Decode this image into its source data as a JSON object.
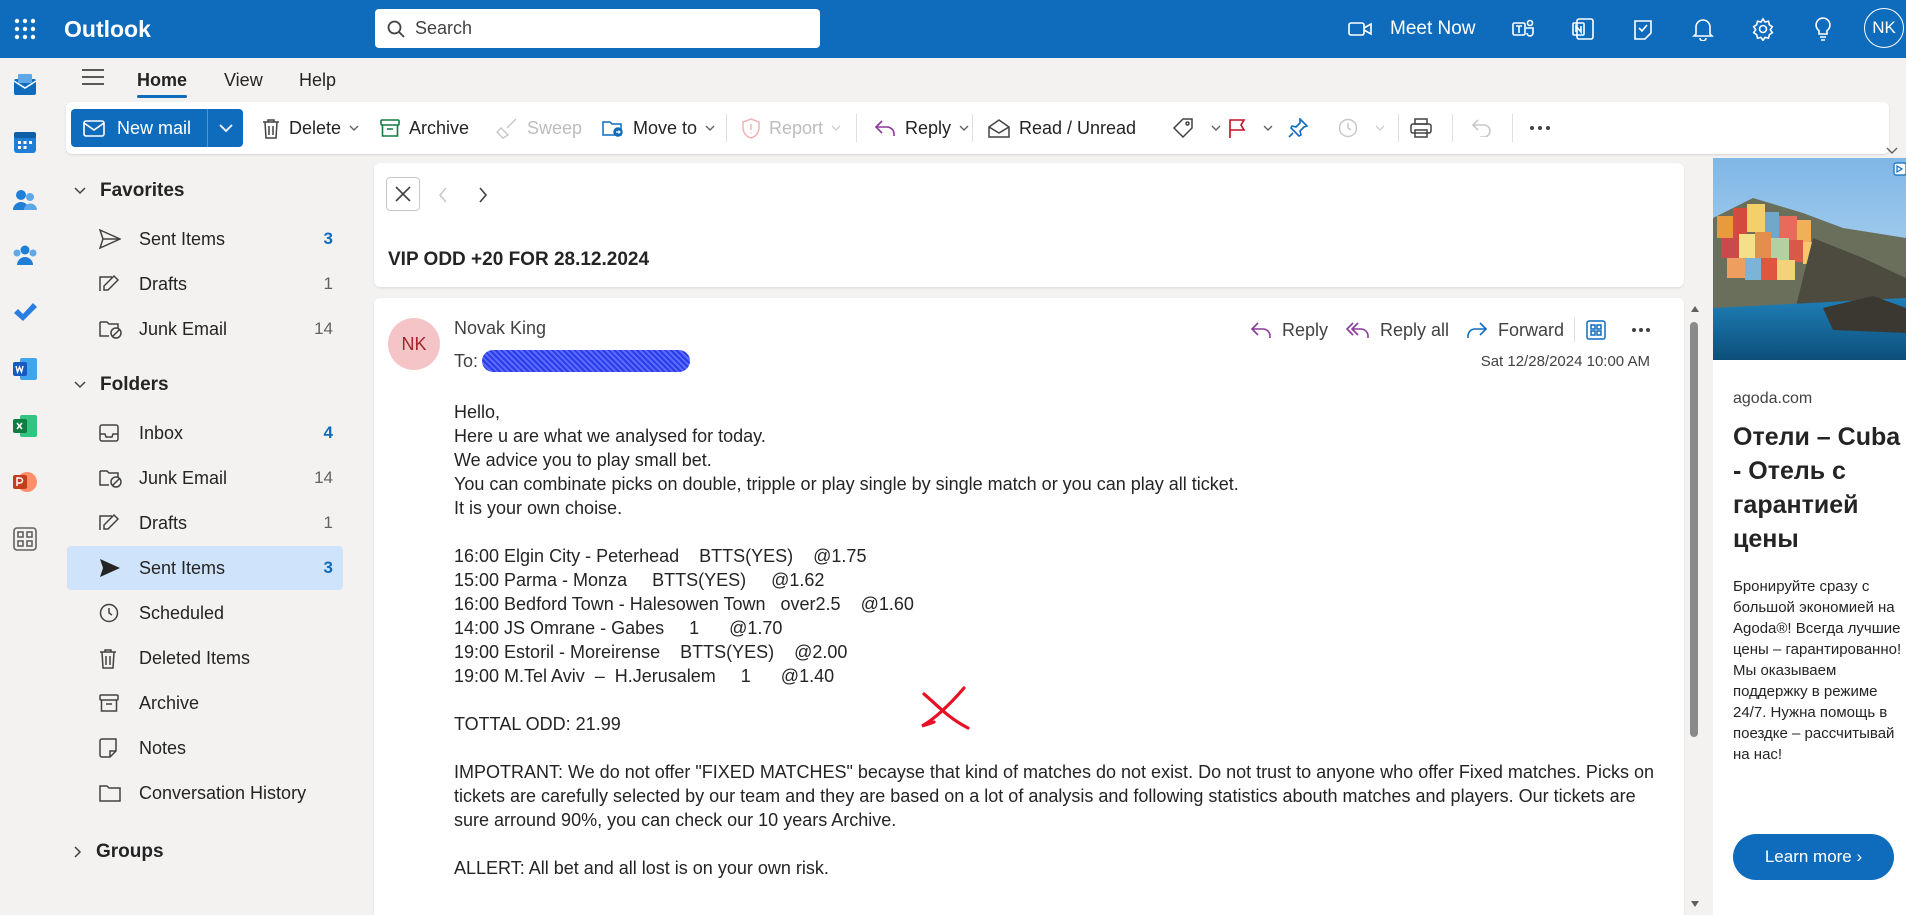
{
  "app": {
    "name": "Outlook",
    "user_initials": "NK"
  },
  "search": {
    "placeholder": "Search"
  },
  "topbar": {
    "meet_now": "Meet Now"
  },
  "tabs": [
    "Home",
    "View",
    "Help"
  ],
  "ribbon": {
    "new_mail": "New mail",
    "delete": "Delete",
    "archive": "Archive",
    "sweep": "Sweep",
    "move_to": "Move to",
    "report": "Report",
    "reply": "Reply",
    "read_unread": "Read / Unread"
  },
  "favorites": {
    "heading": "Favorites",
    "items": [
      {
        "label": "Sent Items",
        "count": "3"
      },
      {
        "label": "Drafts",
        "count": "1"
      },
      {
        "label": "Junk Email",
        "count": "14"
      }
    ]
  },
  "folders": {
    "heading": "Folders",
    "items": [
      {
        "label": "Inbox",
        "count": "4"
      },
      {
        "label": "Junk Email",
        "count": "14"
      },
      {
        "label": "Drafts",
        "count": "1"
      },
      {
        "label": "Sent Items",
        "count": "3"
      },
      {
        "label": "Scheduled",
        "count": ""
      },
      {
        "label": "Deleted Items",
        "count": ""
      },
      {
        "label": "Archive",
        "count": ""
      },
      {
        "label": "Notes",
        "count": ""
      },
      {
        "label": "Conversation History",
        "count": ""
      }
    ]
  },
  "groups": {
    "heading": "Groups"
  },
  "message": {
    "subject": "VIP ODD +20 FOR 28.12.2024",
    "sender_initials": "NK",
    "sender_name": "Novak King",
    "to_label": "To:",
    "date": "Sat 12/28/2024 10:00 AM",
    "actions": {
      "reply": "Reply",
      "reply_all": "Reply all",
      "forward": "Forward"
    },
    "body": {
      "intro": [
        "Hello,",
        "Here u are what we analysed for today.",
        "We advice you to play small bet.",
        "You can combinate picks on double, tripple or play single by single match or you can play all ticket.",
        "It is your own choise."
      ],
      "picks": [
        "16:00 Elgin City - Peterhead    BTTS(YES)    @1.75",
        "15:00 Parma - Monza     BTTS(YES)     @1.62",
        "16:00 Bedford Town - Halesowen Town   over2.5    @1.60",
        "14:00 JS Omrane - Gabes     1      @1.70",
        "19:00 Estoril - Moreirense    BTTS(YES)    @2.00",
        "19:00 M.Tel Aviv  –  H.Jerusalem     1      @1.40"
      ],
      "total": "TOTTAL ODD: 21.99",
      "important": "IMPOTRANT: We do not offer \"FIXED MATCHES\" becayse that kind of matches do not exist. Do not trust to anyone who offer Fixed matches. Picks on tickets are carefully selected by our team and they are based on a lot of analysis and following statistics abouth matches and players. Our tickets are sure arround 90%, you can check our 10 years Archive.",
      "alert": "ALLERT: All bet and all lost is on your own risk."
    }
  },
  "ad": {
    "domain": "agoda.com",
    "title": "Отели – Cuba - Отель с гарантией цены",
    "text": "Бронируйте сразу с большой экономией на Agoda®! Всегда лучшие цены – гарантированно! Мы оказываем поддержку в режиме 24/7. Нужна помощь в поездке – рассчитывай на нас!",
    "cta": "Learn more ›"
  },
  "colors": {
    "brand": "#0f6cbd",
    "selected": "#cfe4fa",
    "unread_count": "#0f6cbd",
    "annotation": "#e81123"
  }
}
